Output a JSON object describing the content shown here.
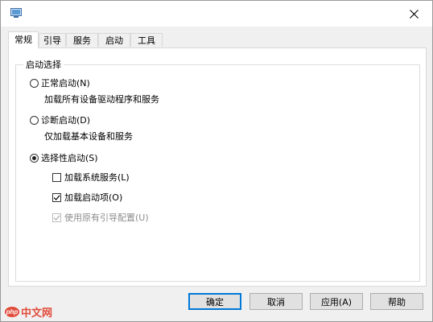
{
  "tabs": [
    {
      "label": "常规",
      "active": true
    },
    {
      "label": "引导",
      "active": false
    },
    {
      "label": "服务",
      "active": false
    },
    {
      "label": "启动",
      "active": false
    },
    {
      "label": "工具",
      "active": false
    }
  ],
  "group": {
    "title": "启动选择",
    "options": [
      {
        "label": "正常启动(N)",
        "description": "加载所有设备驱动程序和服务",
        "checked": false
      },
      {
        "label": "诊断启动(D)",
        "description": "仅加载基本设备和服务",
        "checked": false
      },
      {
        "label": "选择性启动(S)",
        "checked": true
      }
    ],
    "sub_options": [
      {
        "label": "加载系统服务(L)",
        "checked": false,
        "disabled": false
      },
      {
        "label": "加载启动项(O)",
        "checked": true,
        "disabled": false
      },
      {
        "label": "使用原有引导配置(U)",
        "checked": true,
        "disabled": true
      }
    ]
  },
  "buttons": {
    "ok": "确定",
    "cancel": "取消",
    "apply": "应用(A)",
    "help": "帮助"
  },
  "watermark": {
    "logo": "php",
    "text": "中文网"
  },
  "icons": {
    "close": "close-icon",
    "app": "msconfig-app-icon"
  },
  "colors": {
    "accent": "#0078d7",
    "watermark": "#e24b3a"
  }
}
